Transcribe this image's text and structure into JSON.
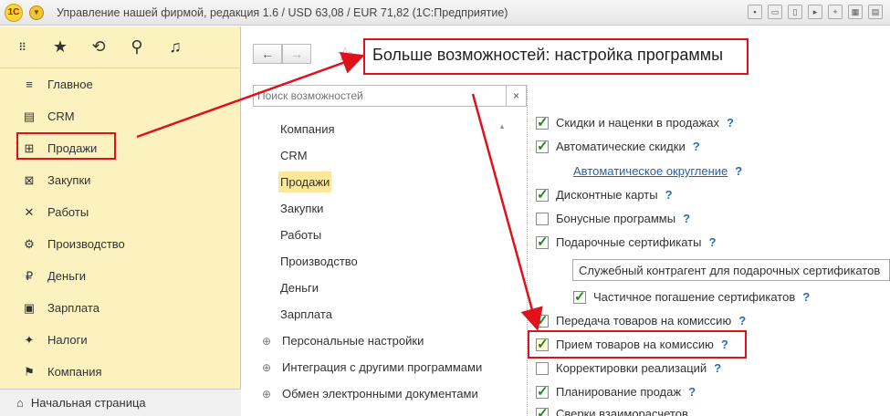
{
  "titlebar": {
    "logo": "1С",
    "title": "Управление нашей фирмой, редакция 1.6 / USD 63,08 / EUR 71,82  (1С:Предприятие)",
    "tools": [
      "save-icon",
      "print-icon",
      "print-preview-icon",
      "bookmark-icon",
      "add-icon",
      "calendar-icon",
      "calculator-icon"
    ]
  },
  "sidebar": {
    "toolbar": [
      {
        "name": "grid-icon",
        "glyph": "⋮⋮⋮"
      },
      {
        "name": "favorites-icon",
        "glyph": "★"
      },
      {
        "name": "history-icon",
        "glyph": "⟲"
      },
      {
        "name": "search-icon",
        "glyph": "⚲"
      },
      {
        "name": "bell-icon",
        "glyph": "🔔"
      }
    ],
    "items": [
      {
        "label": "Главное",
        "icon": "menu-icon",
        "glyph": "≡"
      },
      {
        "label": "CRM",
        "icon": "crm-icon",
        "glyph": "▤"
      },
      {
        "label": "Продажи",
        "icon": "basket-icon",
        "glyph": "⊞"
      },
      {
        "label": "Закупки",
        "icon": "cart-icon",
        "glyph": "⊠"
      },
      {
        "label": "Работы",
        "icon": "tools-icon",
        "glyph": "✕"
      },
      {
        "label": "Производство",
        "icon": "gear-icon",
        "glyph": "⚙"
      },
      {
        "label": "Деньги",
        "icon": "money-icon",
        "glyph": "₽"
      },
      {
        "label": "Зарплата",
        "icon": "salary-icon",
        "glyph": "▣"
      },
      {
        "label": "Налоги",
        "icon": "emblem-icon",
        "glyph": "✦"
      },
      {
        "label": "Компания",
        "icon": "flag-icon",
        "glyph": "⚑"
      }
    ],
    "home": {
      "label": "Начальная страница",
      "glyph": "⌂"
    }
  },
  "nav": {
    "back": "←",
    "forward": "→",
    "star": "☆"
  },
  "page_title": "Больше возможностей: настройка программы",
  "search": {
    "placeholder": "Поиск возможностей",
    "clear": "×"
  },
  "categories": [
    {
      "label": "Компания"
    },
    {
      "label": "CRM"
    },
    {
      "label": "Продажи"
    },
    {
      "label": "Закупки"
    },
    {
      "label": "Работы"
    },
    {
      "label": "Производство"
    },
    {
      "label": "Деньги"
    },
    {
      "label": "Зарплата"
    },
    {
      "label": "Персональные настройки",
      "expand": "⊕"
    },
    {
      "label": "Интеграция с другими программами",
      "expand": "⊕"
    },
    {
      "label": "Обмен электронными документами",
      "expand": "⊕"
    }
  ],
  "settings": {
    "discounts": {
      "label": "Скидки и наценки в продажах",
      "checked": true
    },
    "auto_discounts": {
      "label": "Автоматические скидки",
      "checked": true
    },
    "auto_rounding": {
      "label": "Автоматическое округление"
    },
    "discount_cards": {
      "label": "Дисконтные карты",
      "checked": true
    },
    "bonus": {
      "label": "Бонусные программы",
      "checked": false
    },
    "gift_certs": {
      "label": "Подарочные сертификаты",
      "checked": true
    },
    "counterparty_field": "Служебный контрагент для подарочных сертификатов",
    "partial_redeem": {
      "label": "Частичное погашение сертификатов",
      "checked": true
    },
    "transfer_commission": {
      "label": "Передача товаров на комиссию",
      "checked": true
    },
    "receive_commission": {
      "label": "Прием товаров на комиссию",
      "checked": true
    },
    "sales_adjust": {
      "label": "Корректировки реализаций",
      "checked": false
    },
    "sales_planning": {
      "label": "Планирование продаж",
      "checked": true
    },
    "reconciliation": {
      "label": "Сверки взаиморасчетов",
      "checked": true
    },
    "help": "?"
  },
  "colors": {
    "highlight": "#e0111a",
    "sidebar_bg": "#fbf2c0",
    "link": "#2a5fa8"
  }
}
